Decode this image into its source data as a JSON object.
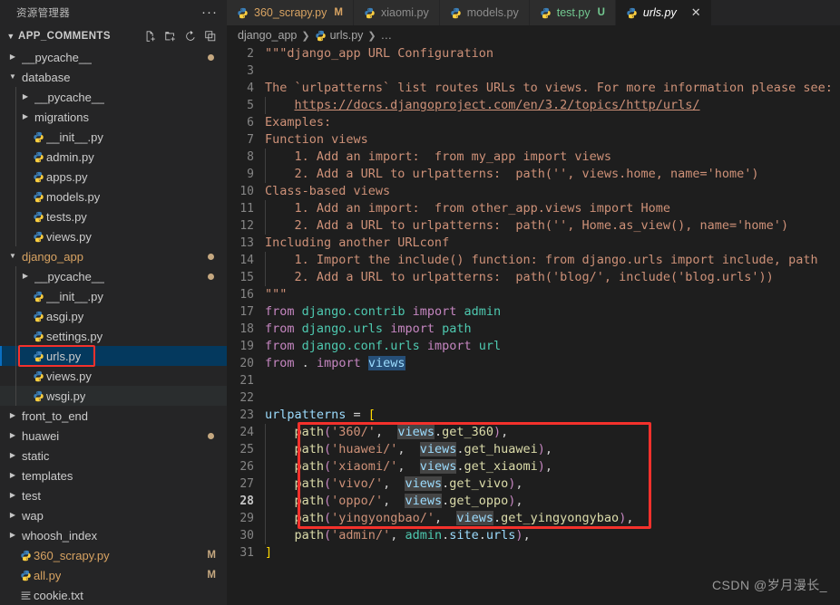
{
  "sidebar": {
    "title": "资源管理器",
    "more_label": "···",
    "section": {
      "label": "APP_COMMENTS",
      "expanded": true
    },
    "actions": [
      {
        "name": "new-file-icon",
        "label": "New File"
      },
      {
        "name": "new-folder-icon",
        "label": "New Folder"
      },
      {
        "name": "refresh-icon",
        "label": "Refresh Explorer"
      },
      {
        "name": "collapse-all-icon",
        "label": "Collapse Folders in Explorer"
      }
    ],
    "tree": [
      {
        "label": "__pycache__",
        "type": "folder",
        "expanded": false,
        "indent": 1,
        "dot": true
      },
      {
        "label": "database",
        "type": "folder",
        "expanded": true,
        "indent": 1
      },
      {
        "label": "__pycache__",
        "type": "folder",
        "expanded": false,
        "indent": 2
      },
      {
        "label": "migrations",
        "type": "folder",
        "expanded": false,
        "indent": 2
      },
      {
        "label": "__init__.py",
        "type": "python",
        "indent": 2
      },
      {
        "label": "admin.py",
        "type": "python",
        "indent": 2
      },
      {
        "label": "apps.py",
        "type": "python",
        "indent": 2
      },
      {
        "label": "models.py",
        "type": "python",
        "indent": 2
      },
      {
        "label": "tests.py",
        "type": "python",
        "indent": 2
      },
      {
        "label": "views.py",
        "type": "python",
        "indent": 2
      },
      {
        "label": "django_app",
        "type": "folder",
        "expanded": true,
        "indent": 1,
        "dot": true,
        "modified": true
      },
      {
        "label": "__pycache__",
        "type": "folder",
        "expanded": false,
        "indent": 2,
        "dot": true
      },
      {
        "label": "__init__.py",
        "type": "python",
        "indent": 2
      },
      {
        "label": "asgi.py",
        "type": "python",
        "indent": 2
      },
      {
        "label": "settings.py",
        "type": "python",
        "indent": 2
      },
      {
        "label": "urls.py",
        "type": "python",
        "indent": 2,
        "selected": true,
        "annotated": true
      },
      {
        "label": "views.py",
        "type": "python",
        "indent": 2
      },
      {
        "label": "wsgi.py",
        "type": "python",
        "indent": 2,
        "hover": true
      },
      {
        "label": "front_to_end",
        "type": "folder",
        "expanded": false,
        "indent": 1
      },
      {
        "label": "huawei",
        "type": "folder",
        "expanded": false,
        "indent": 1,
        "dot": true
      },
      {
        "label": "static",
        "type": "folder",
        "expanded": false,
        "indent": 1
      },
      {
        "label": "templates",
        "type": "folder",
        "expanded": false,
        "indent": 1
      },
      {
        "label": "test",
        "type": "folder",
        "expanded": false,
        "indent": 1
      },
      {
        "label": "wap",
        "type": "folder",
        "expanded": false,
        "indent": 1
      },
      {
        "label": "whoosh_index",
        "type": "folder",
        "expanded": false,
        "indent": 1
      },
      {
        "label": "360_scrapy.py",
        "type": "python",
        "indent": 1,
        "badge": "M",
        "modified": true
      },
      {
        "label": "all.py",
        "type": "python",
        "indent": 1,
        "badge": "M",
        "modified": true
      },
      {
        "label": "cookie.txt",
        "type": "text",
        "indent": 1
      }
    ]
  },
  "tabs": [
    {
      "label": "360_scrapy.py",
      "badge": "M",
      "active": false,
      "icon": "python-icon",
      "modified": true
    },
    {
      "label": "xiaomi.py",
      "badge": "",
      "active": false,
      "icon": "python-icon"
    },
    {
      "label": "models.py",
      "badge": "",
      "active": false,
      "icon": "python-icon"
    },
    {
      "label": "test.py",
      "badge": "U",
      "active": false,
      "icon": "python-icon",
      "untracked": true
    },
    {
      "label": "urls.py",
      "badge": "",
      "active": true,
      "icon": "python-icon",
      "close_label": "✕"
    }
  ],
  "breadcrumb": [
    {
      "label": "django_app",
      "icon": ""
    },
    {
      "label": "urls.py",
      "icon": "python-icon"
    },
    {
      "label": "…",
      "icon": ""
    }
  ],
  "editor": {
    "active_line": 28,
    "first_visible_line": 2,
    "lines": [
      {
        "n": 2,
        "text": "\"\"\"django_app URL Configuration"
      },
      {
        "n": 3,
        "text": ""
      },
      {
        "n": 4,
        "text": "The `urlpatterns` list routes URLs to views. For more information please see:"
      },
      {
        "n": 5,
        "text": "    https://docs.djangoproject.com/en/3.2/topics/http/urls/"
      },
      {
        "n": 6,
        "text": "Examples:"
      },
      {
        "n": 7,
        "text": "Function views"
      },
      {
        "n": 8,
        "text": "    1. Add an import:  from my_app import views"
      },
      {
        "n": 9,
        "text": "    2. Add a URL to urlpatterns:  path('', views.home, name='home')"
      },
      {
        "n": 10,
        "text": "Class-based views"
      },
      {
        "n": 11,
        "text": "    1. Add an import:  from other_app.views import Home"
      },
      {
        "n": 12,
        "text": "    2. Add a URL to urlpatterns:  path('', Home.as_view(), name='home')"
      },
      {
        "n": 13,
        "text": "Including another URLconf"
      },
      {
        "n": 14,
        "text": "    1. Import the include() function: from django.urls import include, path"
      },
      {
        "n": 15,
        "text": "    2. Add a URL to urlpatterns:  path('blog/', include('blog.urls'))"
      },
      {
        "n": 16,
        "text": "\"\"\""
      },
      {
        "n": 17,
        "text": "from django.contrib import admin"
      },
      {
        "n": 18,
        "text": "from django.urls import path"
      },
      {
        "n": 19,
        "text": "from django.conf.urls import url"
      },
      {
        "n": 20,
        "text": "from . import views"
      },
      {
        "n": 21,
        "text": ""
      },
      {
        "n": 22,
        "text": ""
      },
      {
        "n": 23,
        "text": "urlpatterns = ["
      },
      {
        "n": 24,
        "text": "    path('360/',  views.get_360),"
      },
      {
        "n": 25,
        "text": "    path('huawei/',  views.get_huawei),"
      },
      {
        "n": 26,
        "text": "    path('xiaomi/',  views.get_xiaomi),"
      },
      {
        "n": 27,
        "text": "    path('vivo/',  views.get_vivo),"
      },
      {
        "n": 28,
        "text": "    path('oppo/',  views.get_oppo),"
      },
      {
        "n": 29,
        "text": "    path('yingyongbao/',  views.get_yingyongybao),"
      },
      {
        "n": 30,
        "text": "    path('admin/', admin.site.urls),"
      },
      {
        "n": 31,
        "text": "]"
      }
    ]
  },
  "annotations": {
    "color": "#f4312c",
    "file_box_label": "urls.py highlighted in explorer",
    "code_box_label": "urlpatterns routes lines 24-29 highlighted"
  },
  "watermark": "CSDN @岁月漫长_"
}
